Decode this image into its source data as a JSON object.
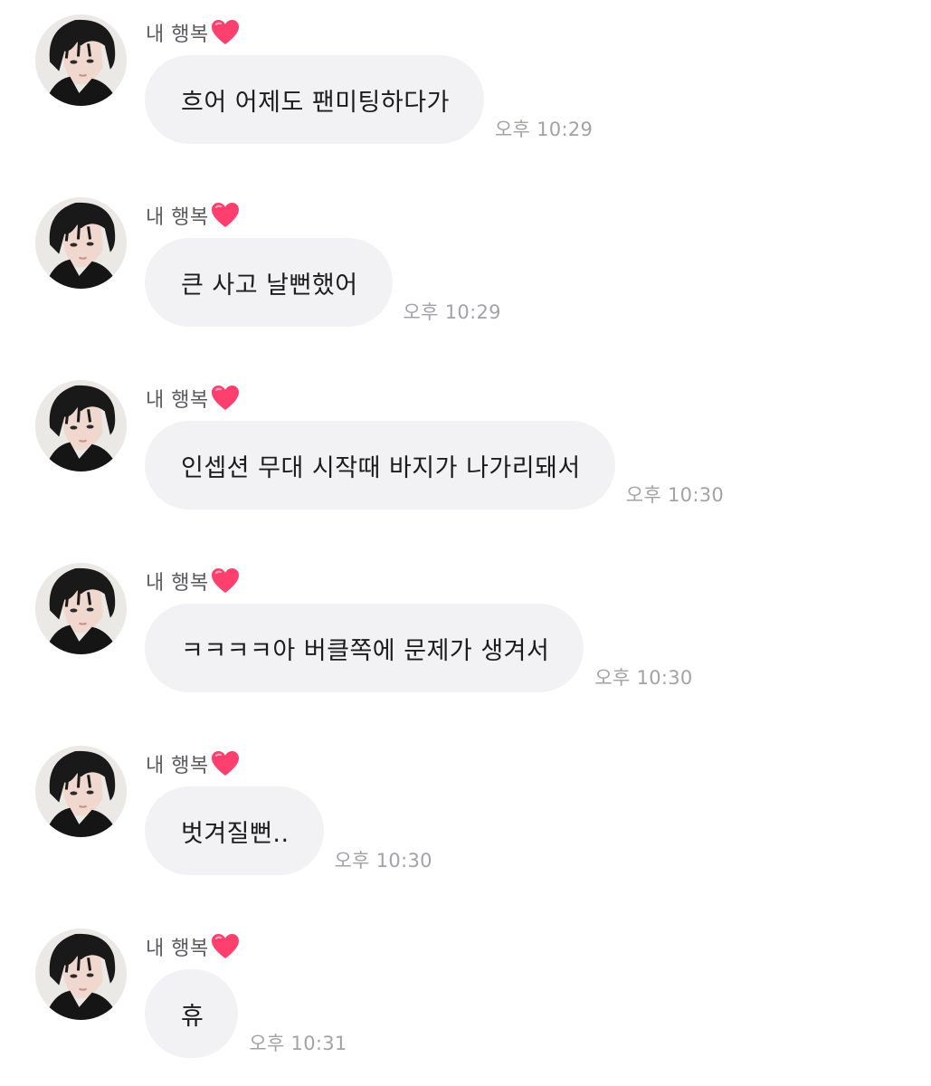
{
  "chat": {
    "messages": [
      {
        "sender": "내 행복",
        "text": "흐어 어제도 팬미팅하다가",
        "time": "오후 10:29"
      },
      {
        "sender": "내 행복",
        "text": "큰 사고 날뻔했어",
        "time": "오후 10:29"
      },
      {
        "sender": "내 행복",
        "text": "인셉션 무대 시작때 바지가 나가리돼서",
        "time": "오후 10:30"
      },
      {
        "sender": "내 행복",
        "text": "ㅋㅋㅋㅋ아 버클쪽에 문제가 생겨서",
        "time": "오후 10:30"
      },
      {
        "sender": "내 행복",
        "text": "벗겨질뻔..",
        "time": "오후 10:30"
      },
      {
        "sender": "내 행복",
        "text": "휴",
        "time": "오후 10:31"
      }
    ]
  },
  "colors": {
    "bubble": "#f2f2f4",
    "time": "#a2a2a8",
    "sender": "#5a5a5e",
    "heart": "#ff3f6e"
  },
  "icons": {
    "sender_emoji": "red-heart-icon",
    "avatar": "profile-photo"
  }
}
